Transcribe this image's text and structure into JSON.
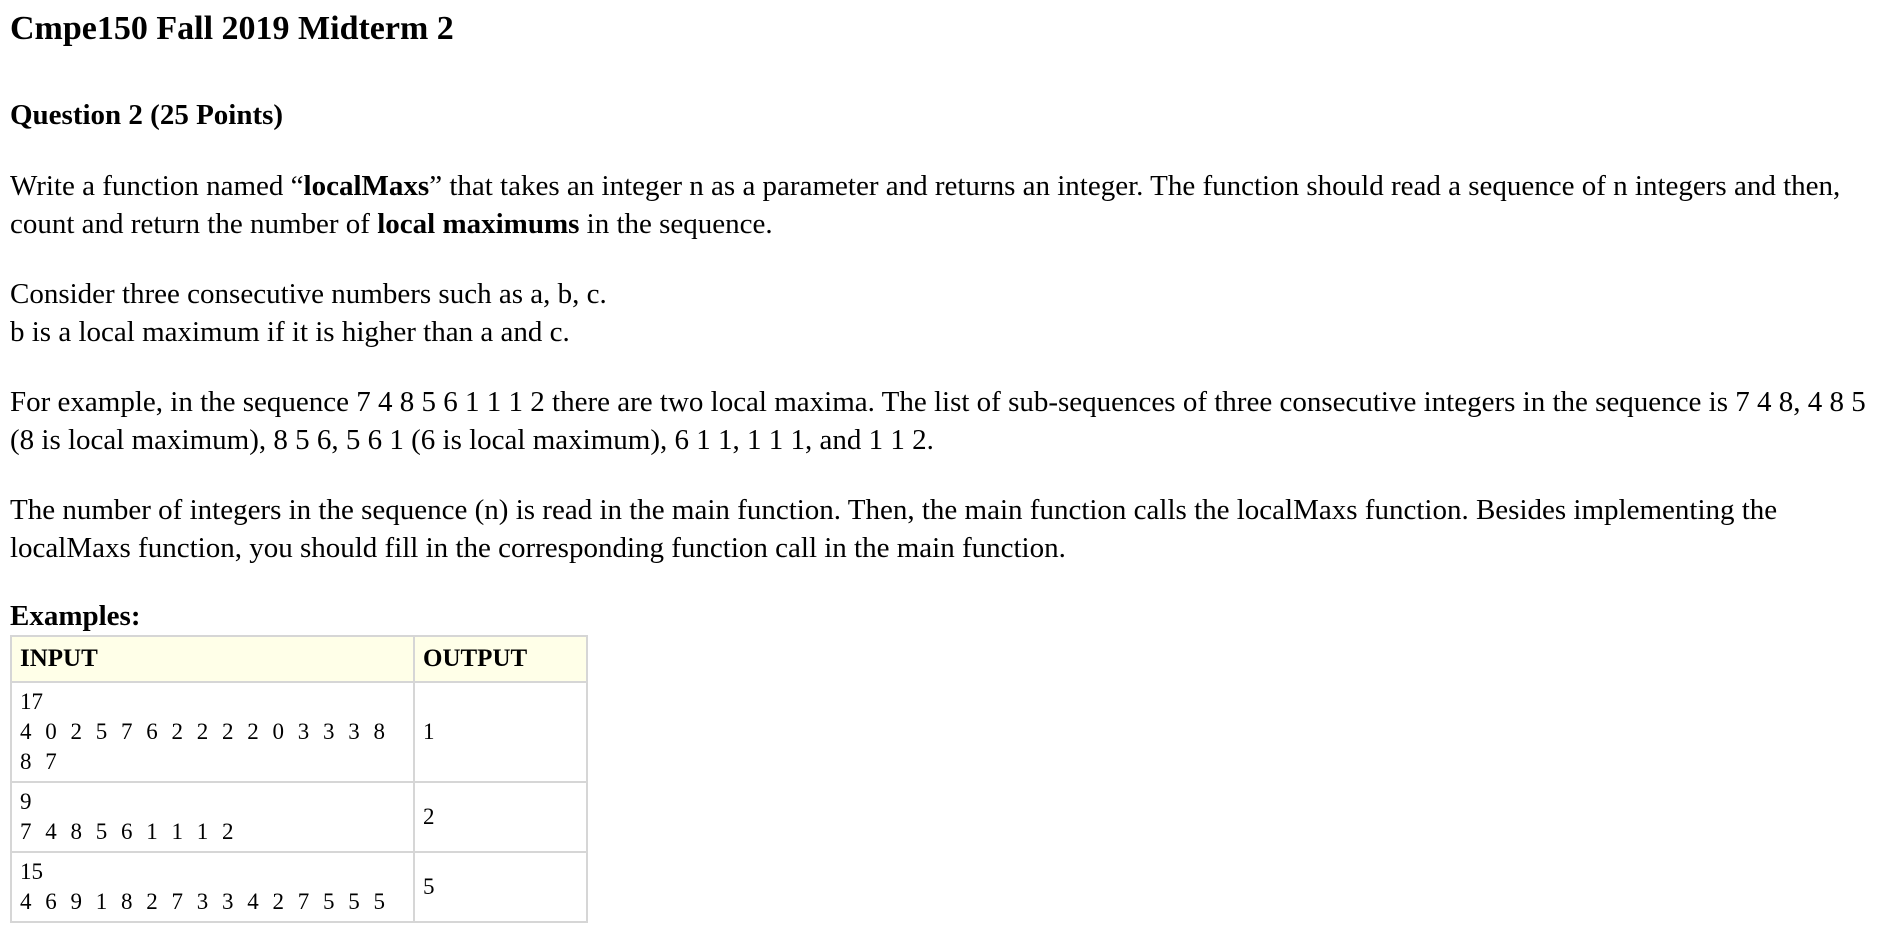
{
  "title": "Cmpe150 Fall 2019 Midterm 2",
  "question_heading": "Question 2 (25 Points)",
  "paragraph1": {
    "pre": "Write a function named “",
    "bold1": "localMaxs",
    "mid1": "” that takes an integer n as a parameter and returns an integer. The function should read a sequence of n integers and then, count and return the number of ",
    "bold2": "local maximums",
    "post": " in the sequence."
  },
  "paragraph2": {
    "line1": "Consider three consecutive numbers such as a, b, c.",
    "line2": "b is a local maximum if it is higher than a and c."
  },
  "paragraph3": "For example, in the sequence 7 4 8 5 6 1 1 1 2 there are two local maxima. The list of sub-sequences of three consecutive integers in the sequence is 7 4 8, 4 8 5 (8 is local maximum), 8 5 6, 5 6 1 (6 is local maximum), 6 1 1, 1 1 1, and 1 1 2.",
  "paragraph4": "The number of integers in the sequence (n) is read in the main function. Then, the main function calls the localMaxs function. Besides implementing the localMaxs function, you should fill in the corresponding function call in the main function.",
  "examples": {
    "title": "Examples:",
    "headers": {
      "input": "INPUT",
      "output": "OUTPUT"
    },
    "rows": [
      {
        "n": "17",
        "sequence": "4 0 2 5 7 6 2 2 2 2 0 3 3 3 8 8 7",
        "output": "1"
      },
      {
        "n": "9",
        "sequence": "7 4 8 5 6 1 1 1 2",
        "output": "2"
      },
      {
        "n": "15",
        "sequence": "4 6 9 1 8 2 7 3 3 4 2 7 5 5 5",
        "output": "5"
      }
    ]
  }
}
